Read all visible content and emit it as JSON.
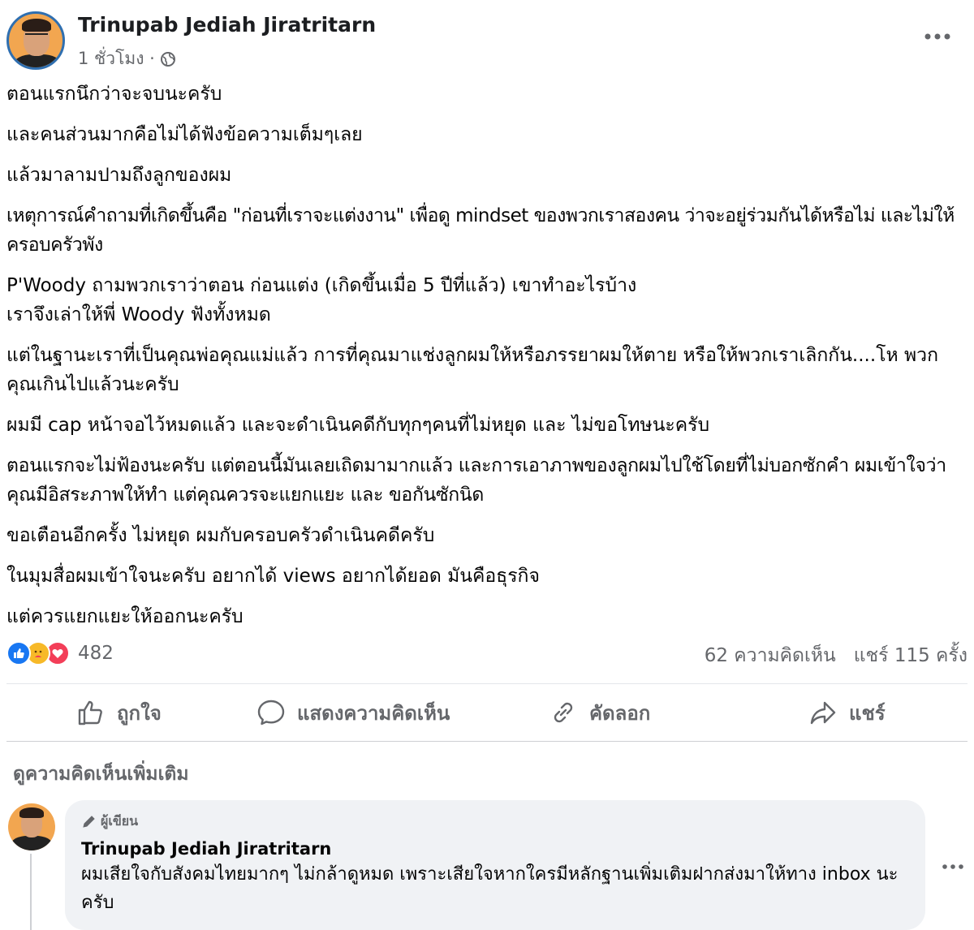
{
  "post": {
    "author": "Trinupab Jediah Jiratritarn",
    "time": "1 ชั่วโมง ·",
    "paragraphs": [
      "ตอนแรกนึกว่าจะจบนะครับ",
      "และคนส่วนมากคือไม่ได้ฟังข้อความเต็มๆเลย",
      "แล้วมาลามปามถึงลูกของผม",
      "เหตุการณ์คำถามที่เกิดขึ้นคือ \"ก่อนที่เราจะแต่งงาน\" เพื่อดู mindset ของพวกเราสองคน ว่าจะอยู่ร่วมกันได้หรือไม่ และไม่ให้ครอบครัวพัง",
      "P'Woody ถามพวกเราว่าตอน ก่อนแต่ง (เกิดขึ้นเมื่อ 5 ปีที่แล้ว) เขาทำอะไรบ้าง\nเราจึงเล่าให้พี่ Woody ฟังทั้งหมด",
      "แต่ในฐานะเราที่เป็นคุณพ่อคุณแม่แล้ว การที่คุณมาแช่งลูกผมให้หรือภรรยาผมให้ตาย หรือให้พวกเราเลิกกัน....โห พวกคุณเกินไปแล้วนะครับ",
      "ผมมี cap หน้าจอไว้หมดแล้ว และจะดำเนินคดีกับทุกๆคนที่ไม่หยุด และ ไม่ขอโทษนะครับ",
      "ตอนแรกจะไม่ฟ้องนะครับ แต่ตอนนี้มันเลยเถิดมามากแล้ว และการเอาภาพของลูกผมไปใช้โดยที่ไม่บอกซักคำ ผมเข้าใจว่าคุณมีอิสระภาพให้ทำ แต่คุณควรจะแยกแยะ และ ขอกันซักนิด",
      "ขอเตือนอีกครั้ง ไม่หยุด ผมกับครอบครัวดำเนินคดีครับ",
      "ในมุมสื่อผมเข้าใจนะครับ อยากได้ views อยากได้ยอด มันคือธุรกิจ",
      "แต่ควรแยกแยะให้ออกนะครับ"
    ]
  },
  "stats": {
    "reactions_count": "482",
    "comments": "62 ความคิดเห็น",
    "shares": "แชร์ 115 ครั้ง",
    "reaction_icons": [
      "like-icon",
      "care-icon",
      "love-icon"
    ]
  },
  "actions": {
    "like": "ถูกใจ",
    "comment": "แสดงความคิดเห็น",
    "copy": "คัดลอก",
    "share": "แชร์"
  },
  "comments_section": {
    "more_label": "ดูความคิดเห็นเพิ่มเติม",
    "comment": {
      "badge": "ผู้เขียน",
      "author": "Trinupab Jediah Jiratritarn",
      "text": "ผมเสียใจกับสังคมไทยมากๆ ไม่กล้าดูหมด เพราะเสียใจหากใครมีหลักฐานเพิ่มเติมฝากส่งมาให้ทาง inbox นะครับ"
    }
  },
  "colors": {
    "like": "#1877f2",
    "care": "#f7b928",
    "love": "#f33e58",
    "secondary_text": "#65676b",
    "comment_bubble": "#f0f2f5"
  }
}
